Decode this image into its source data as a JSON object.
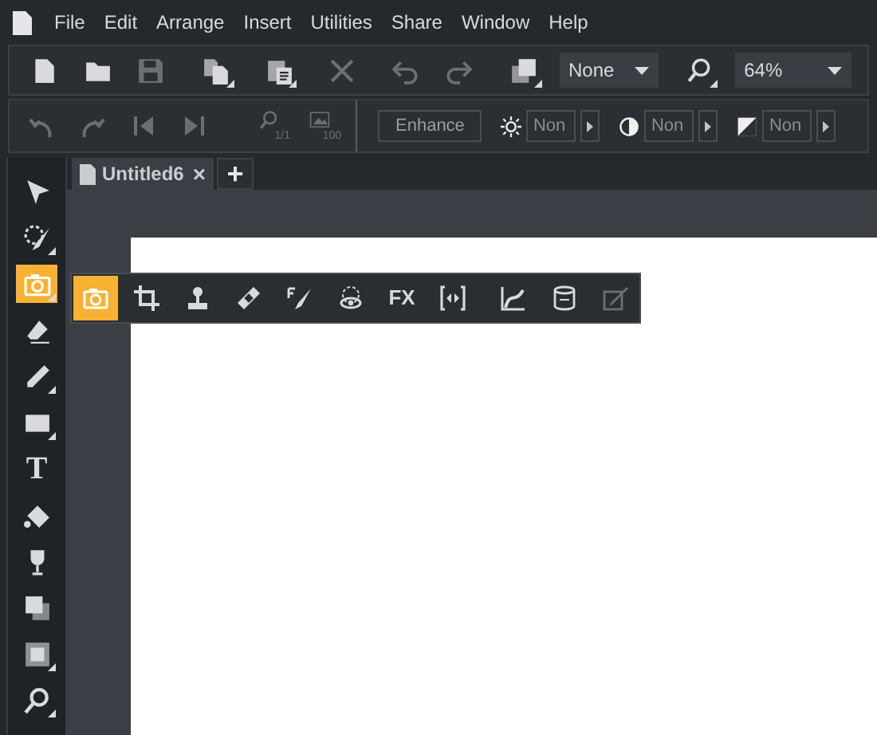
{
  "menu": [
    {
      "label": "File"
    },
    {
      "label": "Edit"
    },
    {
      "label": "Arrange"
    },
    {
      "label": "Insert"
    },
    {
      "label": "Utilities"
    },
    {
      "label": "Share"
    },
    {
      "label": "Window"
    },
    {
      "label": "Help"
    }
  ],
  "toolbar": {
    "buttons": [
      {
        "kind": "new",
        "disabled": false
      },
      {
        "kind": "open",
        "disabled": false
      },
      {
        "kind": "save",
        "disabled": true
      },
      {
        "kind": "copy",
        "disabled": false
      },
      {
        "kind": "paste",
        "disabled": false
      },
      {
        "kind": "delete",
        "disabled": true
      },
      {
        "kind": "undo",
        "disabled": true
      },
      {
        "kind": "redo",
        "disabled": true
      },
      {
        "kind": "arrange",
        "disabled": false
      }
    ],
    "style_select": "None",
    "zoom_select": "64%"
  },
  "toolbar2": {
    "buttons": [
      {
        "kind": "rotate-left",
        "disabled": true
      },
      {
        "kind": "rotate-right",
        "disabled": true
      },
      {
        "kind": "first",
        "disabled": true
      },
      {
        "kind": "last",
        "disabled": true
      },
      {
        "kind": "zoom-actual",
        "caption": "1/1",
        "disabled": true
      },
      {
        "kind": "image-size",
        "caption": "100",
        "disabled": true
      }
    ],
    "enhance": "Enhance",
    "adjustments": [
      {
        "kind": "brightness",
        "value": "Non"
      },
      {
        "kind": "contrast",
        "value": "Non"
      },
      {
        "kind": "exposure",
        "value": "Non"
      }
    ]
  },
  "tabs": [
    {
      "label": "Untitled6",
      "close": "×",
      "selected": true
    }
  ],
  "new_tab": "+",
  "toolbox": [
    {
      "kind": "pointer",
      "selected": false
    },
    {
      "kind": "lasso",
      "selected": false
    },
    {
      "kind": "camera",
      "selected": true
    },
    {
      "kind": "eraser",
      "selected": false
    },
    {
      "kind": "pen",
      "selected": false
    },
    {
      "kind": "rectangle",
      "selected": false
    },
    {
      "kind": "text",
      "label": "T",
      "selected": false
    },
    {
      "kind": "fill",
      "selected": false
    },
    {
      "kind": "glass",
      "selected": false
    },
    {
      "kind": "shadow",
      "selected": false
    },
    {
      "kind": "frame",
      "selected": false
    },
    {
      "kind": "zoom",
      "selected": false
    }
  ],
  "flyout": [
    {
      "kind": "camera",
      "selected": true,
      "disabled": false
    },
    {
      "kind": "crop",
      "selected": false,
      "disabled": false
    },
    {
      "kind": "stamp",
      "selected": false,
      "disabled": false
    },
    {
      "kind": "bandage",
      "selected": false,
      "disabled": false
    },
    {
      "kind": "fx-brush",
      "selected": false,
      "disabled": false
    },
    {
      "kind": "red-eye",
      "selected": false,
      "disabled": false
    },
    {
      "kind": "fx",
      "label": "FX",
      "selected": false,
      "disabled": false
    },
    {
      "kind": "resize",
      "selected": false,
      "disabled": false
    },
    {
      "kind": "curves",
      "selected": false,
      "disabled": false
    },
    {
      "kind": "perspective",
      "selected": false,
      "disabled": false
    },
    {
      "kind": "picker",
      "selected": false,
      "disabled": true
    }
  ]
}
